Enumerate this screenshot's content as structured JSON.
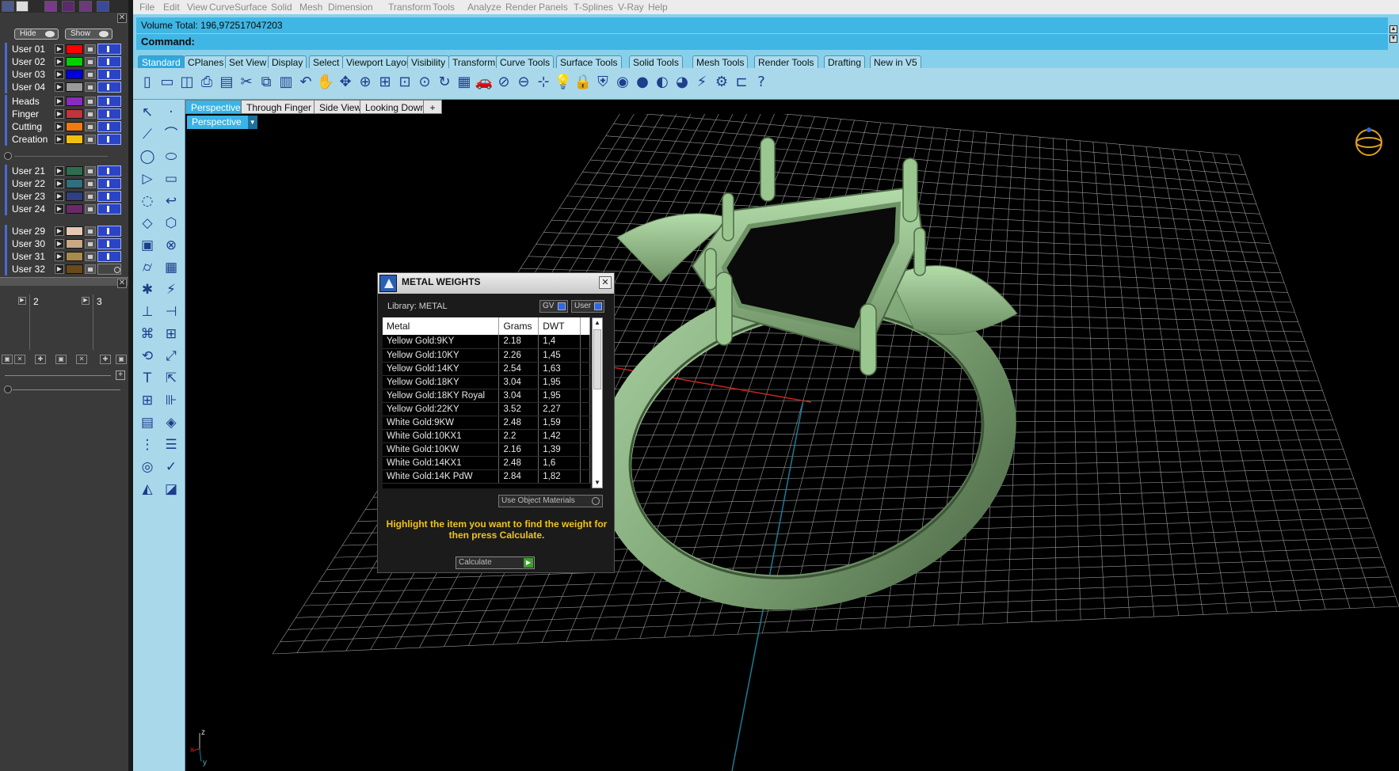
{
  "menu": [
    "File",
    "Edit",
    "View",
    "Curve",
    "Surface",
    "Solid",
    "Mesh",
    "Dimension",
    "Transform",
    "Tools",
    "Analyze",
    "Render",
    "Panels",
    "T-Splines",
    "V-Ray",
    "Help"
  ],
  "command": {
    "history": "Volume Total: 196,972517047203",
    "prompt": "Command:"
  },
  "toolbar_tabs": [
    "Standard",
    "CPlanes",
    "Set View",
    "Display",
    "Select",
    "Viewport Layout",
    "Visibility",
    "Transform",
    "Curve Tools",
    "Surface Tools",
    "Solid Tools",
    "Mesh Tools",
    "Render Tools",
    "Drafting",
    "New in V5"
  ],
  "toolbar_icons": [
    "new-icon",
    "open-icon",
    "save-icon",
    "print-icon",
    "import-icon",
    "cut-icon",
    "copy-icon",
    "paste-icon",
    "undo-icon",
    "pan-hand-icon",
    "move-icon",
    "zoom-icon",
    "zoom-window-icon",
    "zoom-extents-icon",
    "zoom-selected-icon",
    "rotate-view-icon",
    "four-view-icon",
    "car-icon",
    "lock-view-icon",
    "cplane-icon",
    "points-icon",
    "light-bulb-icon",
    "lock-icon",
    "shield-icon",
    "color-wheel-icon",
    "sphere-icon",
    "sphere-shaded-icon",
    "sphere-blue-icon",
    "lightning-icon",
    "gear-icon",
    "snap-icon",
    "help-icon"
  ],
  "layers": {
    "hide_label": "Hide",
    "show_label": "Show",
    "groups": [
      [
        {
          "name": "User 01",
          "color": "#ff0000",
          "on": true
        },
        {
          "name": "User 02",
          "color": "#00d000",
          "on": true
        },
        {
          "name": "User 03",
          "color": "#0000e0",
          "on": true
        },
        {
          "name": "User 04",
          "color": "#9a9a9a",
          "on": true
        }
      ],
      [
        {
          "name": "Heads",
          "color": "#8a2bc0",
          "on": true
        },
        {
          "name": "Finger",
          "color": "#c0343c",
          "on": true
        },
        {
          "name": "Cutting",
          "color": "#f07a10",
          "on": true
        },
        {
          "name": "Creation",
          "color": "#f0c010",
          "on": true
        }
      ],
      [
        {
          "name": "User 21",
          "color": "#2c6e4e",
          "on": true
        },
        {
          "name": "User 22",
          "color": "#2f6f7f",
          "on": true
        },
        {
          "name": "User 23",
          "color": "#2f3f7f",
          "on": true
        },
        {
          "name": "User 24",
          "color": "#6a2a6a",
          "on": true
        }
      ],
      [
        {
          "name": "User 29",
          "color": "#e6c8b2",
          "on": true
        },
        {
          "name": "User 30",
          "color": "#c8a882",
          "on": true
        },
        {
          "name": "User 31",
          "color": "#a88a4a",
          "on": true
        },
        {
          "name": "User 32",
          "color": "#6a4a1a",
          "on": false
        }
      ]
    ]
  },
  "thumbs": {
    "col2": "2",
    "col3": "3"
  },
  "left_tools": [
    "arrow-select-icon",
    "point-icon",
    "polyline-icon",
    "control-curve-icon",
    "circle-icon",
    "ellipse-icon",
    "triangle-icon",
    "rectangle-icon",
    "arc-icon",
    "curve-fillet-icon",
    "surface-icon",
    "loft-icon",
    "box-icon",
    "boolean-icon",
    "cylinder-icon",
    "mesh-icon",
    "explode-icon",
    "lightning-tool-icon",
    "trim-icon",
    "split-icon",
    "group-icon",
    "array-icon",
    "rotate-icon",
    "scale-icon",
    "text-icon",
    "dimension-icon",
    "align-icon",
    "ruler-icon",
    "box-edit-icon",
    "gem-icon",
    "grid-icon",
    "stack-icon",
    "analyze-icon",
    "check-icon",
    "render-icon",
    "paint-icon"
  ],
  "viewport": {
    "tabs": [
      "Perspective",
      "Through Finger",
      "Side View",
      "Looking Down"
    ],
    "add_tab": "+",
    "label": "Perspective",
    "axis_z": "z",
    "axis_y": "y",
    "axis_x": "x"
  },
  "dialog": {
    "title": "METAL WEIGHTS",
    "library": "Library: METAL",
    "toggle_gv": "GV",
    "toggle_user": "User",
    "columns": [
      "Metal",
      "Grams",
      "DWT"
    ],
    "rows": [
      [
        "Yellow Gold:9KY",
        "2.18",
        "1,4"
      ],
      [
        "Yellow Gold:10KY",
        "2.26",
        "1,45"
      ],
      [
        "Yellow Gold:14KY",
        "2.54",
        "1,63"
      ],
      [
        "Yellow Gold:18KY",
        "3.04",
        "1,95"
      ],
      [
        "Yellow Gold:18KY Royal",
        "3.04",
        "1,95"
      ],
      [
        "Yellow Gold:22KY",
        "3.52",
        "2,27"
      ],
      [
        "White Gold:9KW",
        "2.48",
        "1,59"
      ],
      [
        "White Gold:10KX1",
        "2.2",
        "1,42"
      ],
      [
        "White Gold:10KW",
        "2.16",
        "1,39"
      ],
      [
        "White Gold:14KX1",
        "2.48",
        "1,6"
      ],
      [
        "White Gold:14K PdW",
        "2.84",
        "1,82"
      ]
    ],
    "use_object_materials": "Use Object Materials",
    "hint": "Highlight the item you want to find the weight for then press Calculate.",
    "calculate": "Calculate"
  },
  "colors": {
    "accent": "#3fb6e3",
    "toolbar_bg": "#a9d8eb",
    "ring": "#8fb98a"
  }
}
